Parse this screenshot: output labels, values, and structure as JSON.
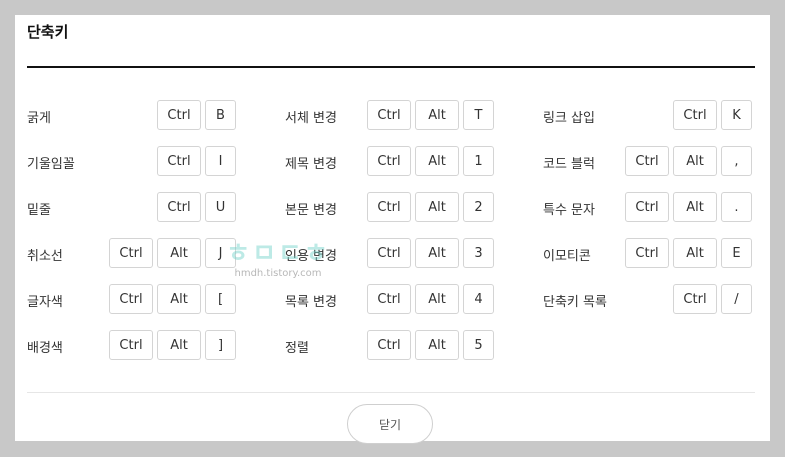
{
  "dialog": {
    "title": "단축키",
    "close_label": "닫기"
  },
  "watermark": {
    "logo_text": "ㅎㅁㄷㅎ",
    "url": "hmdh.tistory.com"
  },
  "columns": [
    {
      "items": [
        {
          "label": "굵게",
          "keys": [
            "Ctrl",
            "B"
          ]
        },
        {
          "label": "기울임꼴",
          "keys": [
            "Ctrl",
            "I"
          ]
        },
        {
          "label": "밑줄",
          "keys": [
            "Ctrl",
            "U"
          ]
        },
        {
          "label": "취소선",
          "keys": [
            "Ctrl",
            "Alt",
            "J"
          ]
        },
        {
          "label": "글자색",
          "keys": [
            "Ctrl",
            "Alt",
            "["
          ]
        },
        {
          "label": "배경색",
          "keys": [
            "Ctrl",
            "Alt",
            "]"
          ]
        }
      ]
    },
    {
      "items": [
        {
          "label": "서체 변경",
          "keys": [
            "Ctrl",
            "Alt",
            "T"
          ]
        },
        {
          "label": "제목 변경",
          "keys": [
            "Ctrl",
            "Alt",
            "1"
          ]
        },
        {
          "label": "본문 변경",
          "keys": [
            "Ctrl",
            "Alt",
            "2"
          ]
        },
        {
          "label": "인용 변경",
          "keys": [
            "Ctrl",
            "Alt",
            "3"
          ]
        },
        {
          "label": "목록 변경",
          "keys": [
            "Ctrl",
            "Alt",
            "4"
          ]
        },
        {
          "label": "정렬",
          "keys": [
            "Ctrl",
            "Alt",
            "5"
          ]
        }
      ]
    },
    {
      "items": [
        {
          "label": "링크 삽입",
          "keys": [
            "Ctrl",
            "K"
          ]
        },
        {
          "label": "코드 블럭",
          "keys": [
            "Ctrl",
            "Alt",
            ","
          ]
        },
        {
          "label": "특수 문자",
          "keys": [
            "Ctrl",
            "Alt",
            "."
          ]
        },
        {
          "label": "이모티콘",
          "keys": [
            "Ctrl",
            "Alt",
            "E"
          ]
        },
        {
          "label": "단축키 목록",
          "keys": [
            "Ctrl",
            "/"
          ]
        }
      ]
    }
  ]
}
